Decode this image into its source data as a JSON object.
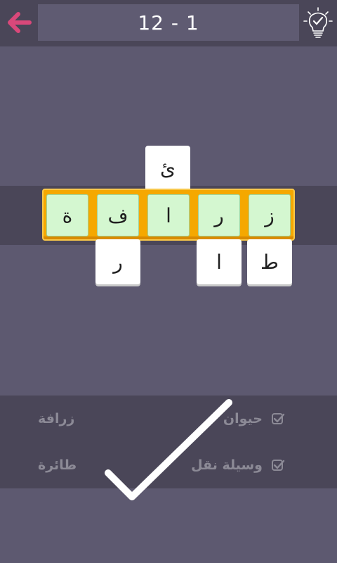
{
  "header": {
    "level_label": "12 - 1",
    "back_icon": "back-arrow-icon",
    "hint_icon": "lightbulb-check-icon",
    "accent_color": "#d9487a"
  },
  "board": {
    "word_row": [
      "ة",
      "ف",
      "ا",
      "ر",
      "ز"
    ],
    "above_tile": "ئ",
    "below_tiles": [
      "ر",
      "ا",
      "ط"
    ]
  },
  "clues": {
    "right": [
      {
        "text": "حيوان",
        "checked": true
      },
      {
        "text": "وسيلة نقل",
        "checked": true
      }
    ],
    "left": [
      {
        "text": "زرافة"
      },
      {
        "text": "طائرة"
      }
    ]
  },
  "overlay": {
    "icon": "big-checkmark-icon",
    "color": "#ffffff"
  }
}
